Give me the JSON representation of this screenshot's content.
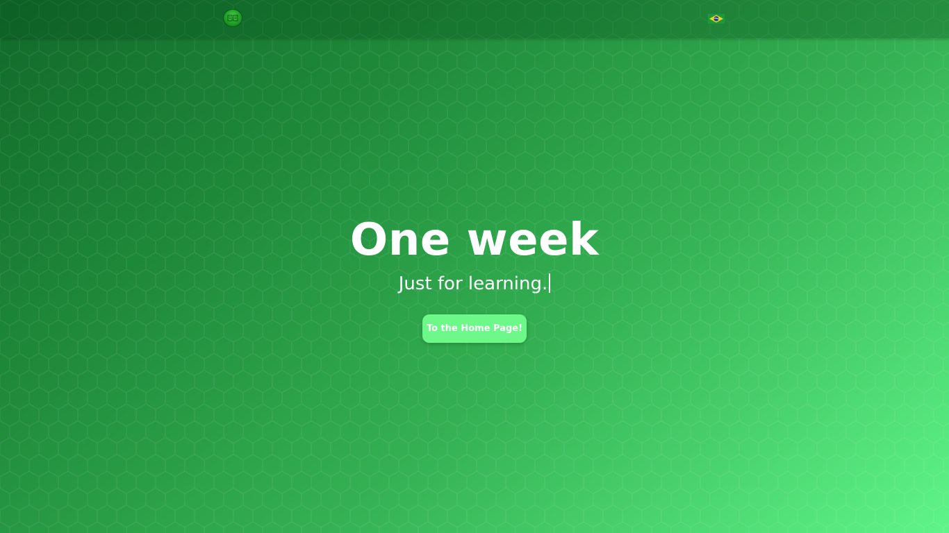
{
  "header": {
    "logo_icon": "book-logo-icon",
    "language_flag_icon": "brazil-flag-icon"
  },
  "hero": {
    "title": "One week",
    "subtitle": "Just for learning."
  },
  "cta": {
    "label": "To the Home Page!"
  },
  "colors": {
    "background_dark": "#11692a",
    "background_light": "#5ff58a",
    "button": "#6cf98a",
    "text": "#ffffff"
  }
}
